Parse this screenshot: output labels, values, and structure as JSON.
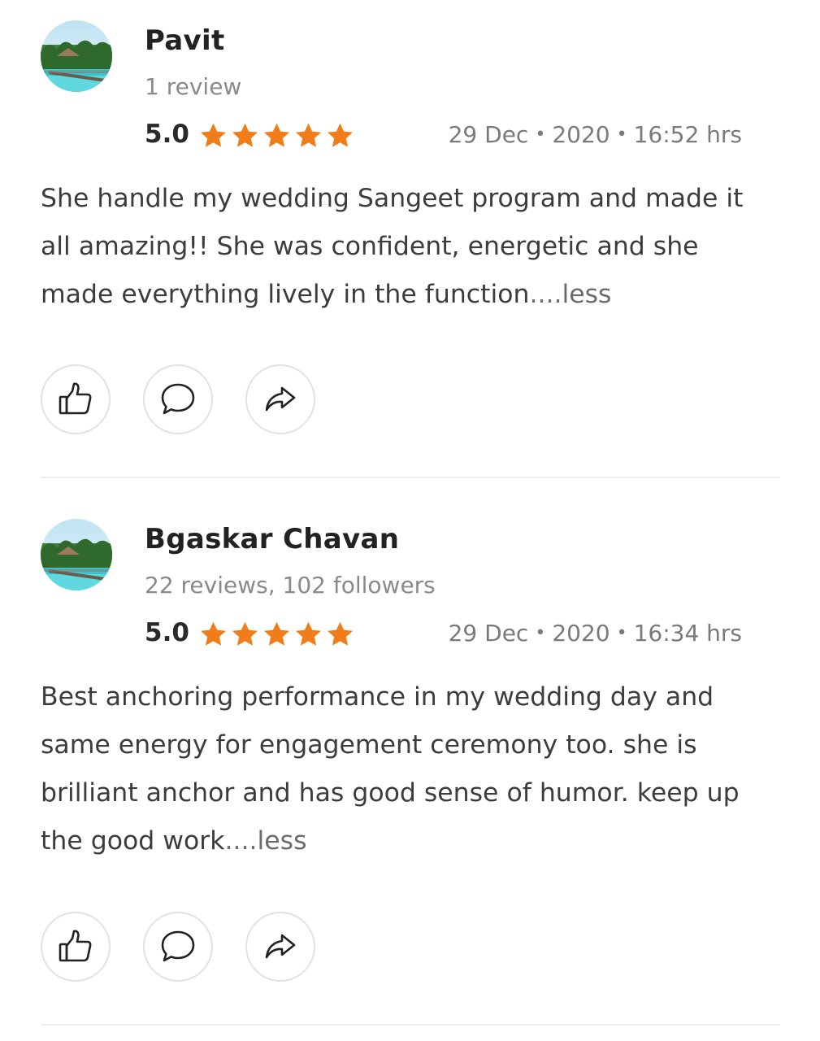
{
  "reviews": [
    {
      "avatar_icon": "beach-resort-avatar",
      "name": "Pavit",
      "meta": "1 review",
      "rating": "5.0",
      "stars": 5,
      "date": "29 Dec",
      "year": "2020",
      "time": "16:52 hrs",
      "text": "She handle my wedding Sangeet program and made it all amazing!! She was confident, energetic and she made everything lively in the function",
      "less_label": "....less",
      "actions": [
        "thumbs-up-icon",
        "comment-icon",
        "share-icon"
      ]
    },
    {
      "avatar_icon": "beach-resort-avatar",
      "name": "Bgaskar Chavan",
      "meta": "22 reviews, 102 followers",
      "rating": "5.0",
      "stars": 5,
      "date": "29 Dec",
      "year": "2020",
      "time": "16:34 hrs",
      "text": "Best anchoring performance in my wedding day and same energy for engagement ceremony too. she is brilliant anchor and has good sense of humor. keep up the good work",
      "less_label": "....less",
      "actions": [
        "thumbs-up-icon",
        "comment-icon",
        "share-icon"
      ]
    }
  ],
  "colors": {
    "star": "#f07c1a",
    "text": "#3c3c3c",
    "muted": "#8a8a8a",
    "divider": "#ececec"
  }
}
